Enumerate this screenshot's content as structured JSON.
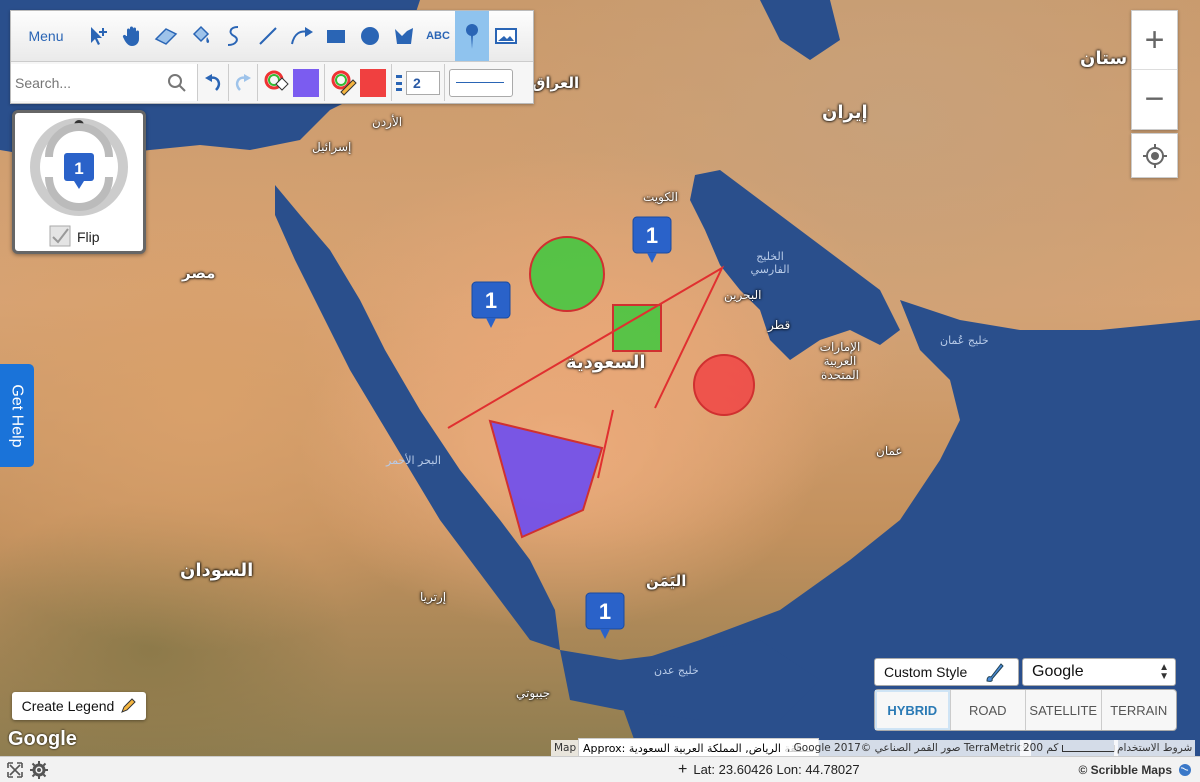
{
  "toolbar": {
    "menu_label": "Menu",
    "tools": [
      "move-tool",
      "pan-tool",
      "eraser-tool",
      "fill-tool",
      "freehand-tool",
      "line-tool",
      "arrow-tool",
      "rectangle-tool",
      "circle-tool",
      "polygon-tool",
      "text-tool",
      "marker-tool",
      "overlay-tool"
    ],
    "text_tool_label": "ABC",
    "active_tool": "marker-tool",
    "search_placeholder": "Search...",
    "fill_color": "#7b5cf0",
    "stroke_color": "#f04040",
    "line_width": "2"
  },
  "flip": {
    "count": "1",
    "label": "Flip"
  },
  "get_help": "Get Help",
  "create_legend": "Create Legend",
  "custom_style": "Custom Style",
  "provider": "Google",
  "map_types": [
    "HYBRID",
    "ROAD",
    "SATELLITE",
    "TERRAIN"
  ],
  "active_map_type": "HYBRID",
  "markers": [
    "1",
    "1",
    "1"
  ],
  "map_labels": {
    "iraq": "العراق",
    "iran": "إيران",
    "jordan": "الأردن",
    "israel": "إسرائيل",
    "egypt": "مصر",
    "kuwait": "الكويت",
    "gulf": "الخليج الفارسي",
    "bahrain": "البحرين",
    "qatar": "قطر",
    "uae": "الإمارات العربية المتحدة",
    "gulf_oman": "خليج عُمان",
    "oman": "عمان",
    "saudi": "السعودية",
    "red_sea": "البحر الأحمر",
    "sudan": "السودان",
    "eritrea": "إرتريا",
    "yemen": "اليَمَن",
    "gulf_aden": "خليج عدن",
    "djibouti": "جيبوتي",
    "pakistan": "ستان"
  },
  "attribution": {
    "map": "Map",
    "approx": "Approx: منطقة الرياض, المملكة العربية السعودية",
    "data": ", Google 2017© صور القمر الصناعي TerraMetrics",
    "scale": "200 كم",
    "terms": "شروط الاستخدام"
  },
  "google_logo": "Google",
  "status": {
    "coords": "Lat: 23.60426 Lon: 44.78027",
    "brand": "© Scribble Maps"
  },
  "colors": {
    "accent": "#1a73d9",
    "water": "#2a4f8c",
    "green_shape": "#3ec83e",
    "red_shape": "#f04545",
    "purple_shape": "#6d4cf0"
  }
}
